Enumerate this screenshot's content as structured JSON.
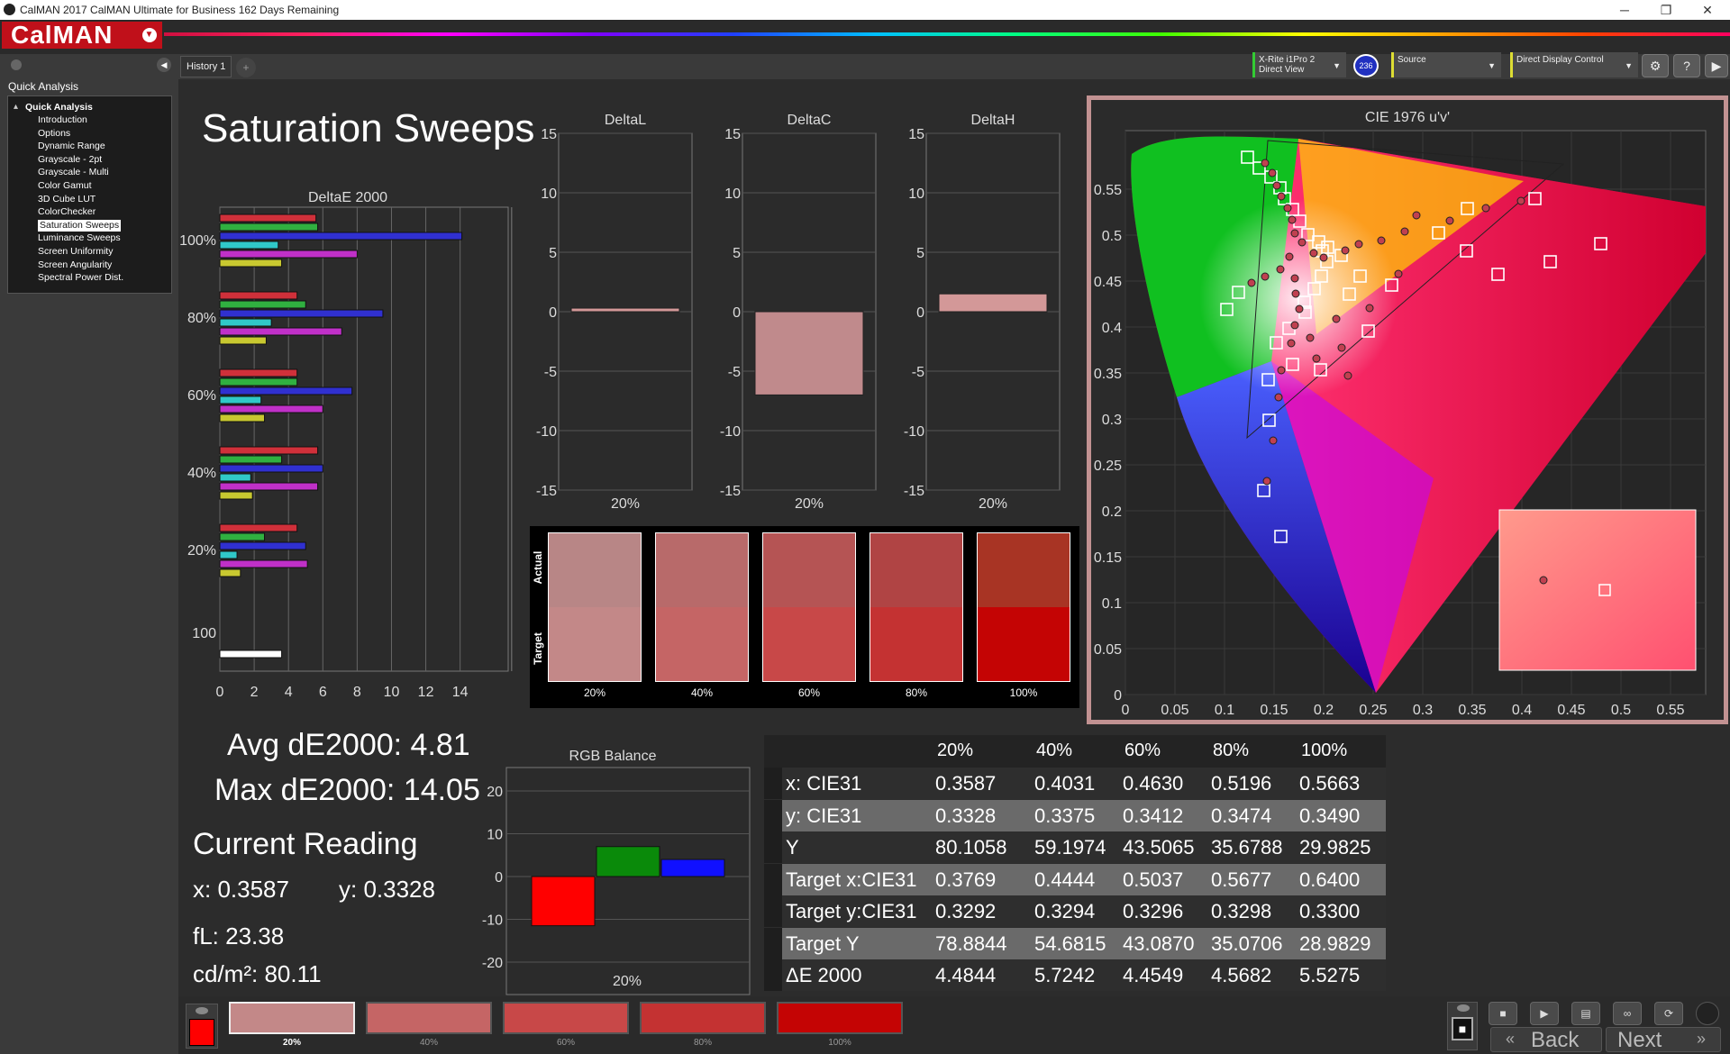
{
  "window": {
    "title": "CalMAN 2017 CalMAN Ultimate for Business 162 Days Remaining",
    "minimize": "─",
    "maximize": "❐",
    "close": "✕"
  },
  "brand": {
    "name": "CalMAN"
  },
  "tabs": [
    {
      "label": "History 1"
    }
  ],
  "toolbar": {
    "meter_line1": "X-Rite i1Pro 2",
    "meter_line2": "Direct View",
    "badge": "236",
    "source": "Source",
    "display": "Direct Display Control"
  },
  "sidebar": {
    "header": "Quick Analysis",
    "root": "Quick Analysis",
    "items": [
      "Introduction",
      "Options",
      "Dynamic Range",
      "Grayscale - 2pt",
      "Grayscale - Multi",
      "Color Gamut",
      "3D Cube LUT",
      "ColorChecker",
      "Saturation Sweeps",
      "Luminance Sweeps",
      "Screen Uniformity",
      "Screen Angularity",
      "Spectral Power Dist."
    ],
    "selected": "Saturation Sweeps"
  },
  "page": {
    "title": "Saturation Sweeps"
  },
  "deltaE": {
    "title": "DeltaE 2000",
    "y_labels": [
      "100%",
      "80%",
      "60%",
      "40%",
      "20%",
      "100"
    ],
    "x_ticks": [
      "0",
      "2",
      "4",
      "6",
      "8",
      "10",
      "12",
      "14"
    ],
    "groups": [
      {
        "label": "100%",
        "values": [
          5.6,
          5.7,
          14.1,
          3.4,
          8.0,
          3.6
        ]
      },
      {
        "label": "80%",
        "values": [
          4.5,
          5.0,
          9.5,
          3.0,
          7.1,
          2.7
        ]
      },
      {
        "label": "60%",
        "values": [
          4.5,
          4.5,
          7.7,
          2.4,
          6.0,
          2.6
        ]
      },
      {
        "label": "40%",
        "values": [
          5.7,
          3.6,
          6.0,
          1.8,
          5.7,
          1.9
        ]
      },
      {
        "label": "20%",
        "values": [
          4.5,
          2.6,
          5.0,
          1.0,
          5.1,
          1.2
        ]
      },
      {
        "label": "100",
        "values": [
          3.6
        ]
      }
    ],
    "colors": [
      "#d0303a",
      "#30b040",
      "#3030d0",
      "#30c8c8",
      "#c030c8",
      "#c8c830",
      "#ffffff"
    ]
  },
  "delta_charts": [
    {
      "title": "DeltaL",
      "value": 0.3,
      "category": "20%"
    },
    {
      "title": "DeltaC",
      "value": -7.0,
      "category": "20%"
    },
    {
      "title": "DeltaH",
      "value": 1.5,
      "category": "20%"
    }
  ],
  "delta_ticks": [
    "15",
    "10",
    "5",
    "0",
    "-5",
    "-10",
    "-15"
  ],
  "swatches": {
    "actual_label": "Actual",
    "target_label": "Target",
    "items": [
      {
        "label": "20%",
        "actual": "#b88686",
        "target": "#c38888"
      },
      {
        "label": "40%",
        "actual": "#b86a6a",
        "target": "#c56565"
      },
      {
        "label": "60%",
        "actual": "#b55454",
        "target": "#c84848"
      },
      {
        "label": "80%",
        "actual": "#b04444",
        "target": "#c43232"
      },
      {
        "label": "100%",
        "actual": "#a83424",
        "target": "#c40404"
      }
    ]
  },
  "cie": {
    "title": "CIE 1976 u'v'",
    "x_ticks": [
      "0",
      "0.05",
      "0.1",
      "0.15",
      "0.2",
      "0.25",
      "0.3",
      "0.35",
      "0.4",
      "0.45",
      "0.5",
      "0.55"
    ],
    "y_ticks": [
      "0",
      "0.05",
      "0.1",
      "0.15",
      "0.2",
      "0.25",
      "0.3",
      "0.35",
      "0.4",
      "0.45",
      "0.5",
      "0.55"
    ]
  },
  "stats": {
    "avg": "Avg dE2000: 4.81",
    "max": "Max dE2000: 14.05",
    "current_reading": "Current Reading",
    "x": "x: 0.3587",
    "y": "y: 0.3328",
    "fl": "fL: 23.38",
    "cdm2": "cd/m²: 80.11"
  },
  "rgb_balance": {
    "title": "RGB Balance",
    "category": "20%",
    "ticks": [
      "20",
      "10",
      "0",
      "-10",
      "-20"
    ],
    "values": {
      "red": -11.5,
      "green": 7.0,
      "blue": 4.0
    }
  },
  "table": {
    "headers": [
      "",
      "20%",
      "40%",
      "60%",
      "80%",
      "100%"
    ],
    "rows": [
      [
        "x: CIE31",
        "0.3587",
        "0.4031",
        "0.4630",
        "0.5196",
        "0.5663"
      ],
      [
        "y: CIE31",
        "0.3328",
        "0.3375",
        "0.3412",
        "0.3474",
        "0.3490"
      ],
      [
        "Y",
        "80.1058",
        "59.1974",
        "43.5065",
        "35.6788",
        "29.9825"
      ],
      [
        "Target x:CIE31",
        "0.3769",
        "0.4444",
        "0.5037",
        "0.5677",
        "0.6400"
      ],
      [
        "Target y:CIE31",
        "0.3292",
        "0.3294",
        "0.3296",
        "0.3298",
        "0.3300"
      ],
      [
        "Target Y",
        "78.8844",
        "54.6815",
        "43.0870",
        "35.0706",
        "28.9829"
      ],
      [
        "ΔE 2000",
        "4.4844",
        "5.7242",
        "4.4549",
        "4.5682",
        "5.5275"
      ]
    ]
  },
  "bottom": {
    "swatches": [
      {
        "label": "20%",
        "color": "#c38888"
      },
      {
        "label": "40%",
        "color": "#c56565"
      },
      {
        "label": "60%",
        "color": "#c84848"
      },
      {
        "label": "80%",
        "color": "#c43232"
      },
      {
        "label": "100%",
        "color": "#c40404"
      }
    ],
    "back": "Back",
    "next": "Next"
  }
}
